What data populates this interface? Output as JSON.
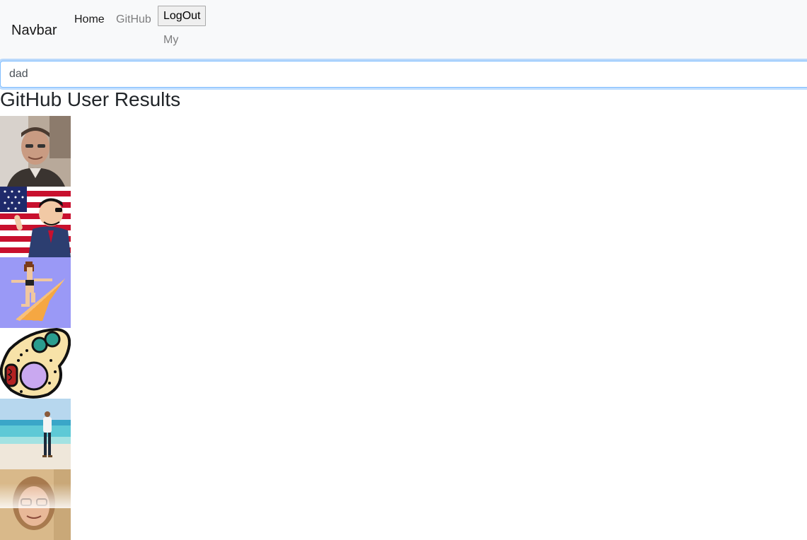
{
  "navbar": {
    "brand": "Navbar",
    "links": {
      "home": "Home",
      "github": "GitHub",
      "my": "My"
    },
    "logout_label": "LogOut"
  },
  "search": {
    "value": "dad"
  },
  "results": {
    "title": "GitHub User Results",
    "avatars": [
      {
        "icon": "person-photo-avatar"
      },
      {
        "icon": "cartoon-flag-avatar"
      },
      {
        "icon": "pixel-art-surfer-avatar"
      },
      {
        "icon": "cell-illustration-avatar"
      },
      {
        "icon": "beach-photo-avatar"
      },
      {
        "icon": "person-photo-avatar"
      }
    ]
  },
  "colors": {
    "navbar_bg": "#f8f9fa",
    "input_focus_border": "#80bdff",
    "text": "#212529"
  }
}
